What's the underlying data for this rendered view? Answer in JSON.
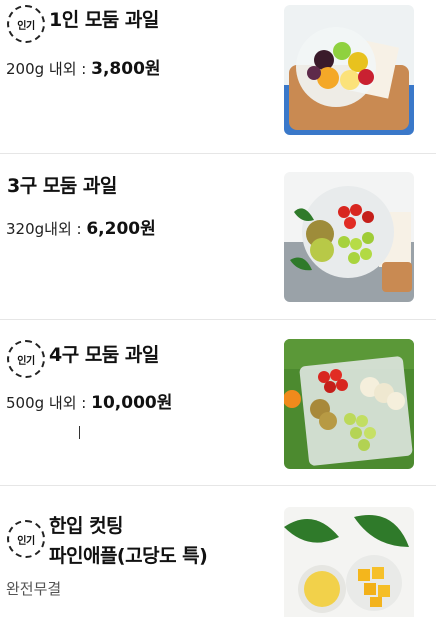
{
  "items": [
    {
      "badge": "인기",
      "title": "1인 모둠 과일",
      "weight_label": "200g 내외 : ",
      "price": "3,800원"
    },
    {
      "title": "3구 모둠 과일",
      "weight_label": "320g내외 : ",
      "price": "6,200원"
    },
    {
      "badge": "인기",
      "title": "4구 모둠 과일",
      "weight_label": "500g 내외 : ",
      "price": "10,000원"
    },
    {
      "badge": "인기",
      "title_line1": "한입 컷팅",
      "title_line2": "파인애플(고당도 특)",
      "status": "완전무결"
    }
  ],
  "images": [
    {
      "icon": "fruit-cup-image"
    },
    {
      "icon": "kiwi-grape-tomato-bowl-image"
    },
    {
      "icon": "four-compartment-fruit-tray-image"
    },
    {
      "icon": "pineapple-bowl-image"
    }
  ]
}
